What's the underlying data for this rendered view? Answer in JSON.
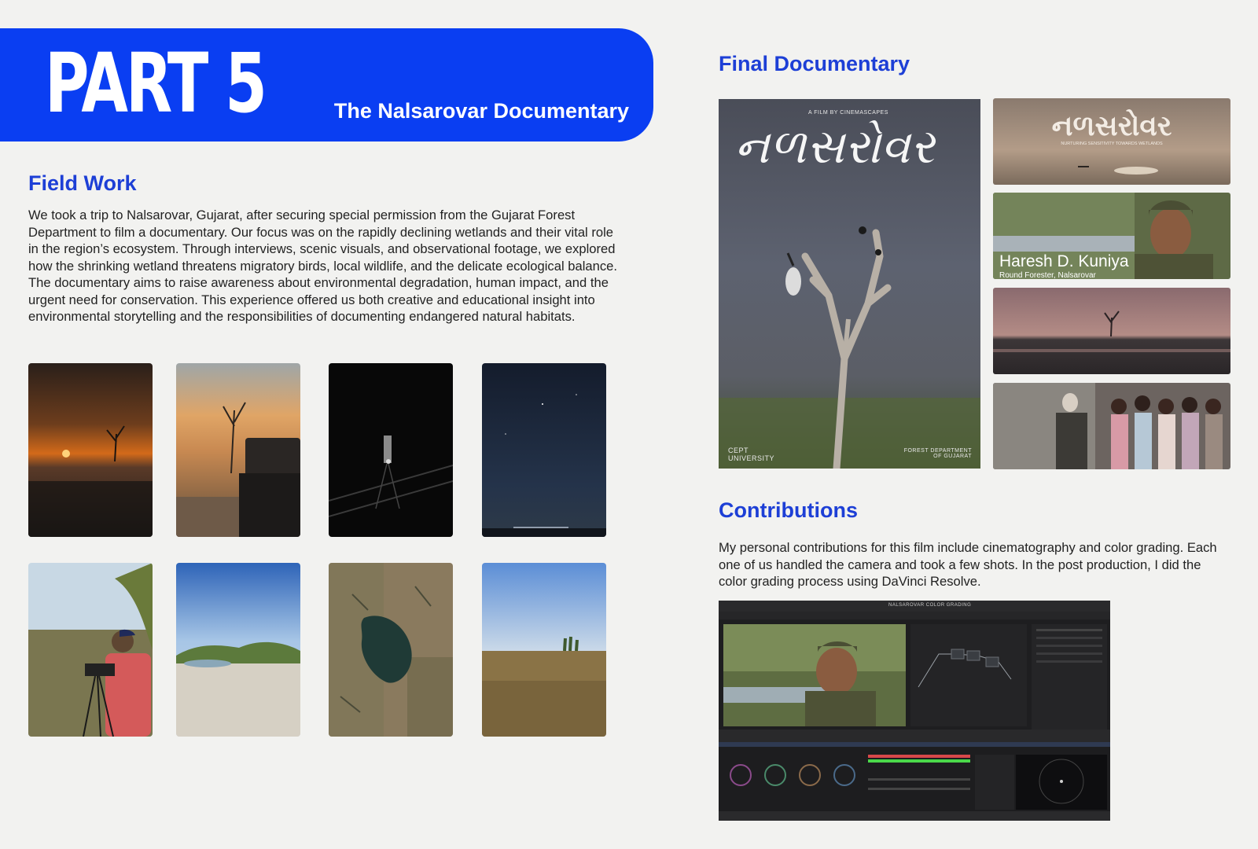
{
  "header": {
    "part_label": "PART 5",
    "subtitle": "The Nalsarovar Documentary"
  },
  "field_work": {
    "heading": "Field Work",
    "body": "We took a trip to Nalsarovar, Gujarat, after securing special permission from the Gujarat Forest Department to film a documentary. Our focus was on the rapidly declining wetlands and their vital role in the region’s ecosystem. Through interviews, scenic visuals, and observational footage, we explored how the shrinking wetland threatens migratory birds, local wildlife, and the delicate ecological balance. The documentary aims to raise awareness about environmental degradation, human impact, and the urgent need for conservation. This experience offered us both creative and educational insight into environmental storytelling and the responsibilities of documenting endangered natural habitats."
  },
  "final_documentary": {
    "heading": "Final Documentary",
    "poster": {
      "top_credit": "A FILM BY CINEMASCAPES",
      "title_script": "નળસરોવર",
      "bottom_left": "CEPT UNIVERSITY",
      "bottom_right": "FOREST DEPARTMENT OF GUJARAT"
    },
    "stills": {
      "title_card": "નળસરોવર",
      "title_tagline": "NURTURING SENSITIVITY TOWARDS WETLANDS",
      "interview_name": "Haresh D. Kuniya",
      "interview_role": "Round Forester, Nalsarovar"
    }
  },
  "contributions": {
    "heading": "Contributions",
    "body": "My personal contributions for this film include cinematography and color grading. Each one of us handled the camera and took a few shots. In the post production, I did the color grading process using DaVinci Resolve.",
    "screenshot_title": "NALSAROVAR COLOR GRADING"
  },
  "colors": {
    "accent_blue": "#0a3ef2",
    "heading_blue": "#1d3fd6",
    "background": "#f2f2f0"
  }
}
